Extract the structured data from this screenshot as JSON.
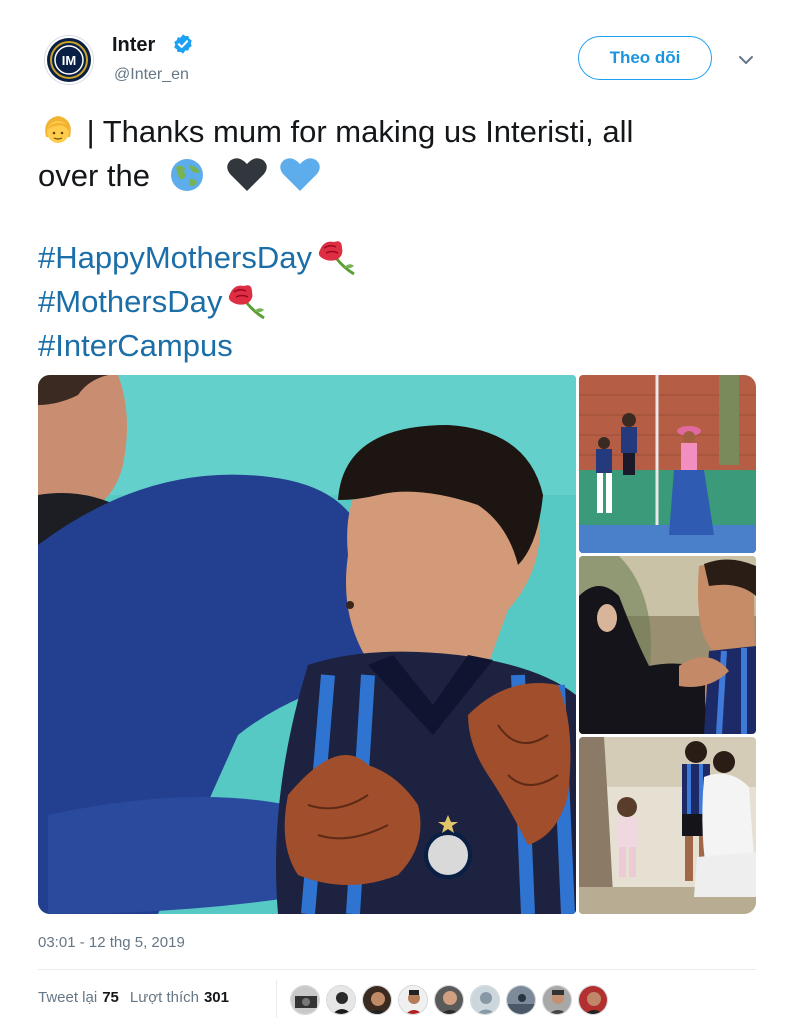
{
  "author": {
    "name": "Inter",
    "handle": "@Inter_en",
    "verified": true,
    "avatar_icon": "inter-logo-icon"
  },
  "follow_button": {
    "label": "Theo dõi"
  },
  "tweet": {
    "text_line1": "| Thanks mum for making us Interisti, all",
    "text_line2": "over the",
    "emojis": [
      "woman-emoji",
      "globe-emoji",
      "black-heart-emoji",
      "blue-heart-emoji"
    ],
    "hashtags": [
      "#HappyMothersDay",
      "#MothersDay",
      "#InterCampus"
    ]
  },
  "media": {
    "count": 4,
    "items": [
      {
        "name": "main-photo"
      },
      {
        "name": "photo-2"
      },
      {
        "name": "photo-3"
      },
      {
        "name": "photo-4"
      }
    ]
  },
  "meta": {
    "timestamp": "03:01 - 12 thg 5, 2019"
  },
  "stats": {
    "retweets_label": "Tweet lại",
    "retweets_count": "75",
    "likes_label": "Lượt thích",
    "likes_count": "301",
    "liker_avatar_count": 9
  },
  "colors": {
    "accent": "#1da1f2",
    "hashtag": "#1b6ea8",
    "secondary_text": "#657786"
  }
}
